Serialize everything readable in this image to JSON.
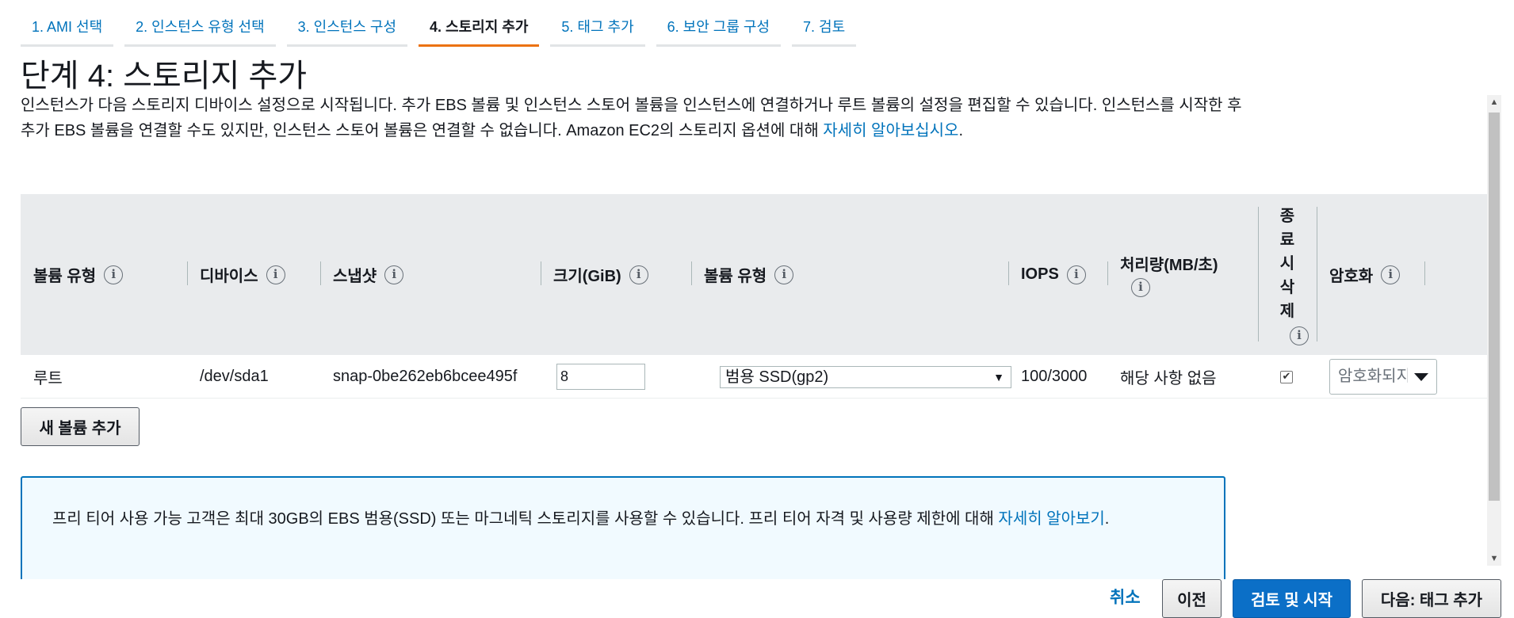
{
  "tabs": [
    {
      "label": "1. AMI 선택"
    },
    {
      "label": "2. 인스턴스 유형 선택"
    },
    {
      "label": "3. 인스턴스 구성"
    },
    {
      "label": "4. 스토리지 추가"
    },
    {
      "label": "5. 태그 추가"
    },
    {
      "label": "6. 보안 그룹 구성"
    },
    {
      "label": "7. 검토"
    }
  ],
  "page": {
    "title": "단계 4: 스토리지 추가",
    "description": "인스턴스가 다음 스토리지 디바이스 설정으로 시작됩니다. 추가 EBS 볼륨 및 인스턴스 스토어 볼륨을 인스턴스에 연결하거나 루트 볼륨의 설정을 편집할 수 있습니다. 인스턴스를 시작한 후 추가 EBS 볼륨을 연결할 수도 있지만, 인스턴스 스토어 볼륨은 연결할 수 없습니다. Amazon EC2의 스토리지 옵션에 대해 ",
    "description_link": "자세히 알아보십시오",
    "description_end": "."
  },
  "table": {
    "headers": {
      "volume_type": "볼륨 유형",
      "device": "디바이스",
      "snapshot": "스냅샷",
      "size": "크기(GiB)",
      "volume_kind": "볼륨 유형",
      "iops": "IOPS",
      "throughput": "처리량(MB/초)",
      "delete_on_termination": [
        "종",
        "료",
        "시",
        "삭",
        "제"
      ],
      "encryption": "암호화"
    },
    "info_glyph": "i",
    "rows": [
      {
        "volume_type": "루트",
        "device": "/dev/sda1",
        "snapshot": "snap-0be262eb6bcee495f",
        "size": "8",
        "volume_kind": "범용 SSD(gp2)",
        "iops": "100/3000",
        "throughput": "해당 사항 없음",
        "delete_on_termination": true,
        "encryption": "암호화되지 않음"
      }
    ],
    "select_arrow": "▼",
    "checkbox_mark": "✔"
  },
  "add_volume_label": "새 볼륨 추가",
  "free_tier": {
    "text": "프리 티어 사용 가능 고객은 최대 30GB의 EBS 범용(SSD) 또는 마그네틱 스토리지를 사용할 수 있습니다. 프리 티어 자격 및 사용량 제한에 대해 ",
    "link": "자세히 알아보기",
    "end": "."
  },
  "footer": {
    "cancel": "취소",
    "previous": "이전",
    "review_launch": "검토 및 시작",
    "next": "다음: 태그 추가"
  },
  "scrollbar": {
    "up": "▲",
    "down": "▼"
  },
  "colors": {
    "link": "#0073bb",
    "active_tab_underline": "#ec7211",
    "header_bg": "#e9ebed",
    "primary_button": "#0b6fc7"
  }
}
